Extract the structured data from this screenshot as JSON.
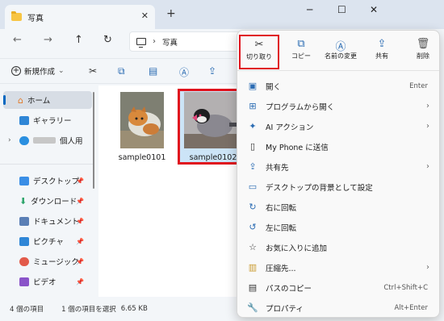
{
  "window": {
    "tab_title": "写真",
    "tab_close": "✕",
    "new_tab": "+",
    "minimize": "─",
    "maximize": "☐",
    "close": "✕"
  },
  "nav": {
    "back": "←",
    "forward": "→",
    "up": "↑",
    "refresh": "↻",
    "breadcrumb_sep": "›",
    "breadcrumb": "写真"
  },
  "toolbar": {
    "new_label": "新規作成",
    "new_chevron": "⌄",
    "icons": [
      "cut-icon",
      "copy-icon",
      "paste-icon",
      "rename-icon",
      "share-icon"
    ]
  },
  "sidebar": {
    "home": "ホーム",
    "gallery": "ギャラリー",
    "onedrive": "個人用",
    "expand": "›",
    "pinned": [
      {
        "label": "デスクトップ",
        "color": "#3a8ee6"
      },
      {
        "label": "ダウンロード",
        "color": "#2fa56c"
      },
      {
        "label": "ドキュメント",
        "color": "#5a7fb5"
      },
      {
        "label": "ピクチャ",
        "color": "#2f86d6"
      },
      {
        "label": "ミュージック",
        "color": "#e25a4a"
      },
      {
        "label": "ビデオ",
        "color": "#8a54c9"
      }
    ],
    "pin_glyph": "📌"
  },
  "files": [
    {
      "name": "sample0101",
      "selected": false
    },
    {
      "name": "sample0102",
      "selected": true
    }
  ],
  "status": {
    "count": "4 個の項目",
    "selection": "1 個の項目を選択",
    "size": "6.65 KB"
  },
  "menu": {
    "actions": [
      {
        "label": "切り取り",
        "icon": "✂"
      },
      {
        "label": "コピー",
        "icon": "⧉"
      },
      {
        "label": "名前の変更",
        "icon": "Ⓐ"
      },
      {
        "label": "共有",
        "icon": "⇪"
      },
      {
        "label": "削除",
        "icon": "🗑"
      }
    ],
    "items": [
      {
        "label": "開く",
        "icon": "▣",
        "shortcut": "Enter",
        "arrow": ""
      },
      {
        "label": "プログラムから開く",
        "icon": "⊞",
        "shortcut": "",
        "arrow": "›"
      },
      {
        "label": "AI アクション",
        "icon": "✦",
        "shortcut": "",
        "arrow": "›"
      },
      {
        "label": "My Phone に送信",
        "icon": "▯",
        "shortcut": "",
        "arrow": ""
      },
      {
        "label": "共有先",
        "icon": "⇪",
        "shortcut": "",
        "arrow": "›"
      },
      {
        "label": "デスクトップの背景として設定",
        "icon": "▭",
        "shortcut": "",
        "arrow": ""
      },
      {
        "label": "右に回転",
        "icon": "↻",
        "shortcut": "",
        "arrow": ""
      },
      {
        "label": "左に回転",
        "icon": "↺",
        "shortcut": "",
        "arrow": ""
      },
      {
        "label": "お気に入りに追加",
        "icon": "☆",
        "shortcut": "",
        "arrow": ""
      },
      {
        "label": "圧縮先...",
        "icon": "▥",
        "shortcut": "",
        "arrow": "›"
      },
      {
        "label": "パスのコピー",
        "icon": "▤",
        "shortcut": "Ctrl+Shift+C",
        "arrow": ""
      },
      {
        "label": "プロパティ",
        "icon": "🔧",
        "shortcut": "Alt+Enter",
        "arrow": ""
      }
    ]
  }
}
